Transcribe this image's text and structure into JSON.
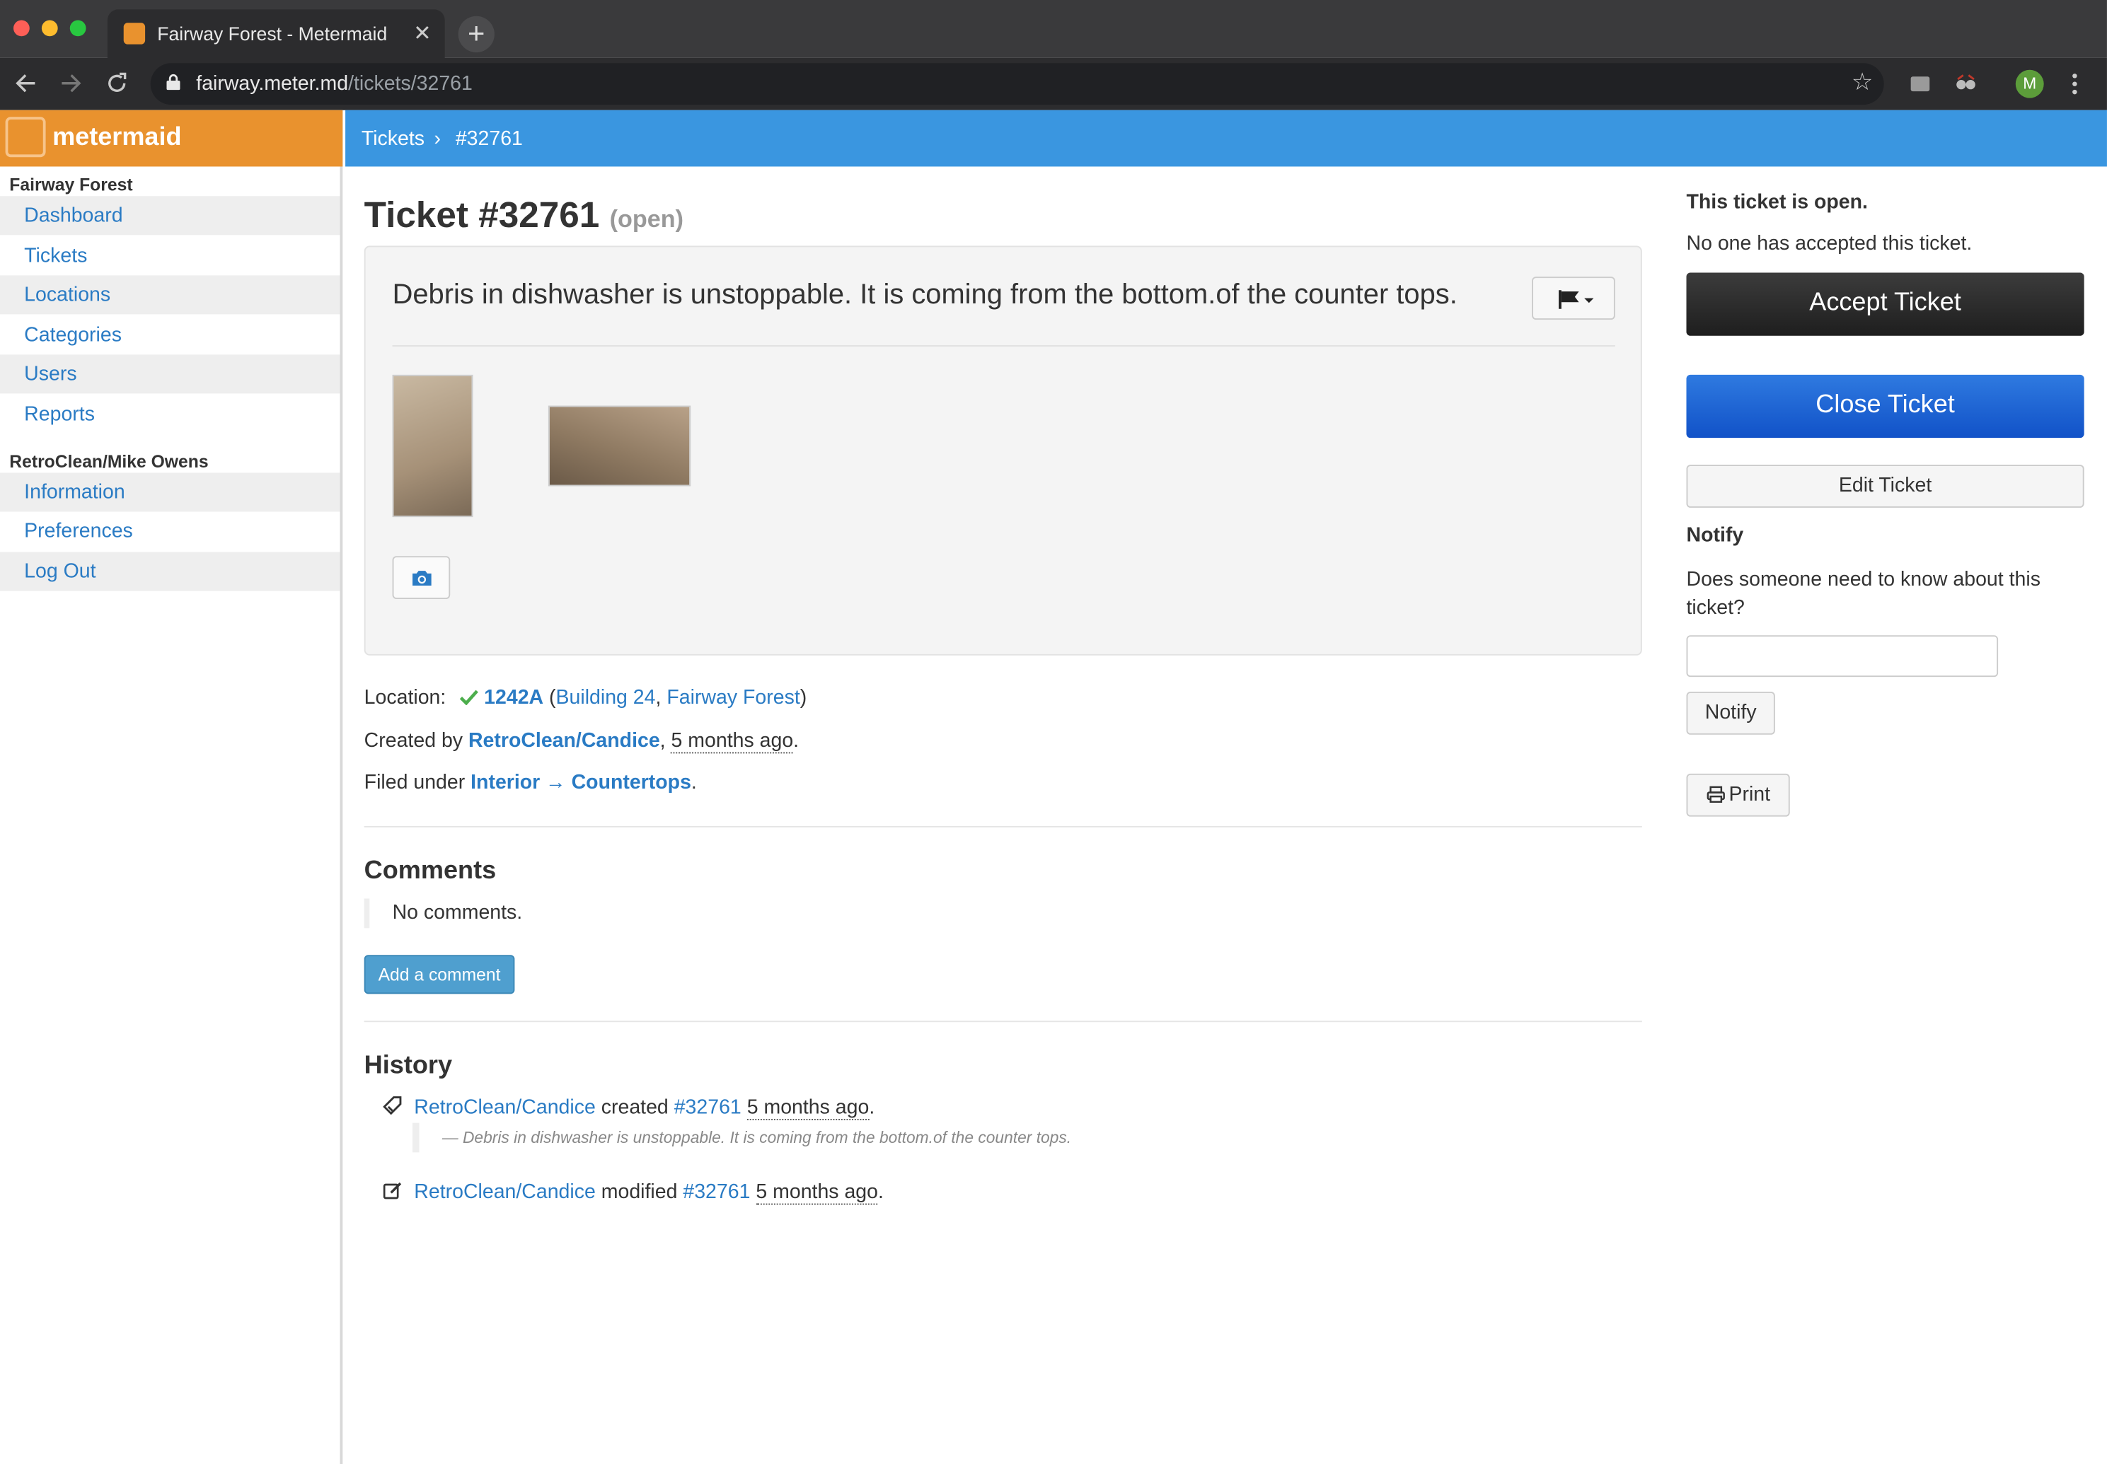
{
  "browser": {
    "tab_title": "Fairway Forest - Metermaid",
    "tab_close": "✕",
    "new_tab": "+",
    "url_host": "fairway.meter.md",
    "url_path": "/tickets/32761",
    "profile_initial": "M"
  },
  "brand": {
    "name": "metermaid",
    "color": "#e9922e"
  },
  "sidebar": {
    "section1": "Fairway Forest",
    "items1": [
      "Dashboard",
      "Tickets",
      "Locations",
      "Categories",
      "Users",
      "Reports"
    ],
    "section2": "RetroClean/Mike Owens",
    "items2": [
      "Information",
      "Preferences",
      "Log Out"
    ]
  },
  "breadcrumb": {
    "root": "Tickets",
    "sep": "›",
    "current": "#32761"
  },
  "ticket": {
    "title": "Ticket #32761",
    "status": "(open)",
    "description": "Debris in dishwasher is unstoppable. It is coming from the bottom.of the counter tops.",
    "location_label": "Location:",
    "location_unit": "1242A",
    "location_building": "Building 24",
    "location_property": "Fairway Forest",
    "created_label": "Created by",
    "created_by": "RetroClean/Candice",
    "created_when": "5 months ago",
    "filed_label": "Filed under",
    "category": "Interior → Countertops"
  },
  "comments": {
    "heading": "Comments",
    "empty": "No comments.",
    "add_label": "Add a comment"
  },
  "history": {
    "heading": "History",
    "entries": [
      {
        "user": "RetroClean/Candice",
        "action": "created",
        "ticket": "#32761",
        "when": "5 months ago",
        "quote": "— Debris in dishwasher is unstoppable. It is coming from the bottom.of the counter tops."
      },
      {
        "user": "RetroClean/Candice",
        "action": "modified",
        "ticket": "#32761",
        "when": "5 months ago"
      }
    ]
  },
  "side": {
    "open_text": "This ticket is open.",
    "accepted_text": "No one has accepted this ticket.",
    "accept_label": "Accept Ticket",
    "close_label": "Close Ticket",
    "edit_label": "Edit Ticket",
    "notify_heading": "Notify",
    "notify_question": "Does someone need to know about this ticket?",
    "notify_value": "",
    "notify_button": "Notify",
    "print_label": "Print"
  },
  "colors": {
    "header_blue": "#3a96e0",
    "link": "#2a7bc4",
    "close_blue": "#1d63d6"
  }
}
